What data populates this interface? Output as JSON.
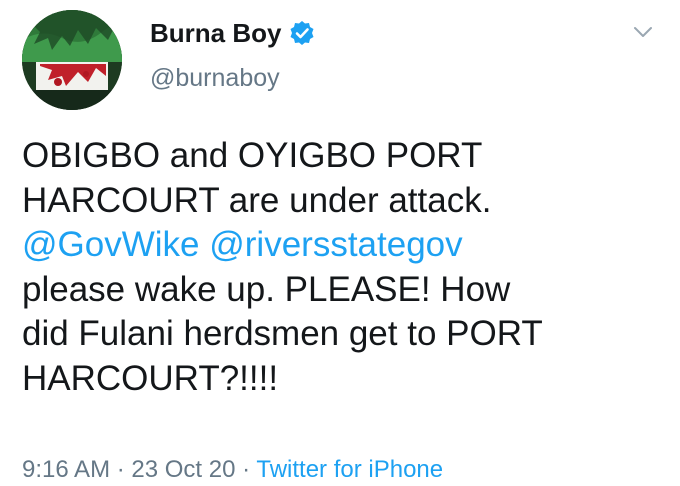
{
  "user": {
    "display_name": "Burna Boy",
    "handle": "@burnaboy"
  },
  "tweet": {
    "line1": "OBIGBO and OYIGBO PORT",
    "line2": "HARCOURT are under attack.",
    "mention1": "@GovWike",
    "mention2": "@riversstategov",
    "line4": "please wake up. PLEASE! How",
    "line5": "did Fulani herdsmen get to PORT",
    "line6": "HARCOURT?!!!!"
  },
  "meta": {
    "time": "9:16 AM",
    "separator1": " · ",
    "date": "23 Oct 20",
    "separator2": " · ",
    "source": "Twitter for iPhone"
  },
  "icons": {
    "verified": "verified-badge-icon",
    "more": "chevron-down-icon"
  },
  "colors": {
    "link": "#1da1f2",
    "secondary_text": "#657786",
    "primary_text": "#14171a"
  }
}
